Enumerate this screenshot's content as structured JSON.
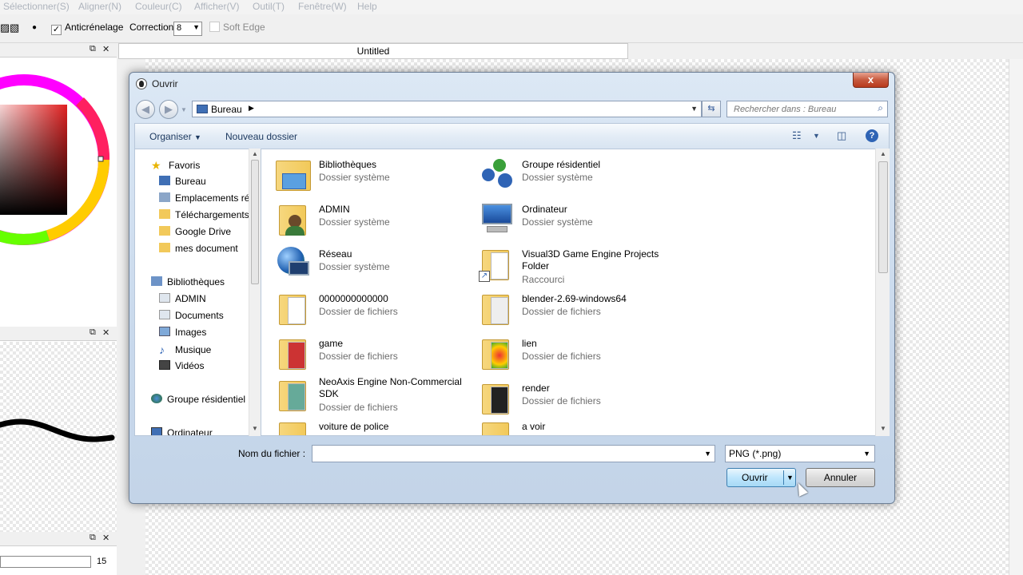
{
  "menu": [
    "Sélectionner(S)",
    "Aligner(N)",
    "Couleur(C)",
    "Afficher(V)",
    "Outil(T)",
    "Fenêtre(W)",
    "Help"
  ],
  "toolbar": {
    "antialias_label": "Anticrénelage",
    "correction_label": "Correction",
    "correction_value": "8",
    "soft_edge_label": "Soft Edge"
  },
  "document_tab": "Untitled",
  "left_panel": {
    "size_value": "15"
  },
  "dialog": {
    "title": "Ouvrir",
    "close_label": "x",
    "address": {
      "crumb": "Bureau"
    },
    "search_placeholder": "Rechercher dans : Bureau",
    "organize_label": "Organiser",
    "new_folder_label": "Nouveau dossier",
    "nav": {
      "favorites_title": "Favoris",
      "favorites": [
        "Bureau",
        "Emplacements ré",
        "Téléchargements",
        "Google Drive",
        "mes document"
      ],
      "libraries_title": "Bibliothèques",
      "libraries": [
        "ADMIN",
        "Documents",
        "Images",
        "Musique",
        "Vidéos"
      ],
      "homegroup": "Groupe résidentiel",
      "computer": "Ordinateur"
    },
    "files": [
      {
        "name": "Bibliothèques",
        "type": "Dossier système",
        "icon": "libraries-icon"
      },
      {
        "name": "Groupe résidentiel",
        "type": "Dossier système",
        "icon": "homegroup-icon"
      },
      {
        "name": "ADMIN",
        "type": "Dossier système",
        "icon": "user-folder-icon"
      },
      {
        "name": "Ordinateur",
        "type": "Dossier système",
        "icon": "computer-icon"
      },
      {
        "name": "Réseau",
        "type": "Dossier système",
        "icon": "network-icon"
      },
      {
        "name": "Visual3D Game Engine Projects Folder",
        "type": "Raccourci",
        "icon": "shortcut-folder-icon"
      },
      {
        "name": "0000000000000",
        "type": "Dossier de fichiers",
        "icon": "folder-icon"
      },
      {
        "name": "blender-2.69-windows64",
        "type": "Dossier de fichiers",
        "icon": "folder-icon"
      },
      {
        "name": "game",
        "type": "Dossier de fichiers",
        "icon": "folder-icon"
      },
      {
        "name": "lien",
        "type": "Dossier de fichiers",
        "icon": "folder-icon"
      },
      {
        "name": "NeoAxis Engine Non-Commercial SDK",
        "type": "Dossier de fichiers",
        "icon": "folder-icon"
      },
      {
        "name": "render",
        "type": "Dossier de fichiers",
        "icon": "folder-icon"
      },
      {
        "name": "voiture de police",
        "type": "",
        "icon": "folder-icon"
      },
      {
        "name": "a voir",
        "type": "",
        "icon": "folder-icon"
      }
    ],
    "filename_label": "Nom du fichier :",
    "filename_value": "",
    "filetype_value": "PNG (*.png)",
    "open_label": "Ouvrir",
    "cancel_label": "Annuler"
  },
  "colors": {
    "accent_blue": "#3c7fb1",
    "folder_yellow": "#f2c95a",
    "close_red": "#c75a3f"
  }
}
